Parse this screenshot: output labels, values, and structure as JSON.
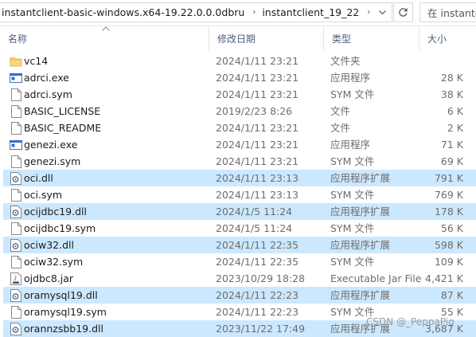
{
  "address_bar": {
    "crumbs": [
      "instantclient-basic-windows.x64-19.22.0.0.0dbru",
      "instantclient_19_22"
    ],
    "separator": "›",
    "dropdown_icon": "chevron-down-icon",
    "refresh_icon": "refresh-icon",
    "search_placeholder": "在 instantcl"
  },
  "columns": {
    "name": "名称",
    "date": "修改日期",
    "type": "类型",
    "size": "大小"
  },
  "colors": {
    "selected": "#cce8ff",
    "folder": "#f8d775",
    "dll_icon": "#5a6b85"
  },
  "files": [
    {
      "name": "vc14",
      "date": "2024/1/11 23:21",
      "type": "文件夹",
      "size": "",
      "icon": "folder-icon",
      "selected": false
    },
    {
      "name": "adrci.exe",
      "date": "2024/1/11 23:21",
      "type": "应用程序",
      "size": "28 K",
      "icon": "exe-icon",
      "selected": false
    },
    {
      "name": "adrci.sym",
      "date": "2024/1/11 23:21",
      "type": "SYM 文件",
      "size": "38 K",
      "icon": "file-icon",
      "selected": false
    },
    {
      "name": "BASIC_LICENSE",
      "date": "2019/2/23 8:26",
      "type": "文件",
      "size": "6 K",
      "icon": "file-icon",
      "selected": false
    },
    {
      "name": "BASIC_README",
      "date": "2024/1/11 23:21",
      "type": "文件",
      "size": "2 K",
      "icon": "file-icon",
      "selected": false
    },
    {
      "name": "genezi.exe",
      "date": "2024/1/11 23:21",
      "type": "应用程序",
      "size": "71 K",
      "icon": "exe-icon",
      "selected": false
    },
    {
      "name": "genezi.sym",
      "date": "2024/1/11 23:21",
      "type": "SYM 文件",
      "size": "69 K",
      "icon": "file-icon",
      "selected": false
    },
    {
      "name": "oci.dll",
      "date": "2024/1/11 23:13",
      "type": "应用程序扩展",
      "size": "791 K",
      "icon": "dll-icon",
      "selected": true
    },
    {
      "name": "oci.sym",
      "date": "2024/1/11 23:13",
      "type": "SYM 文件",
      "size": "769 K",
      "icon": "file-icon",
      "selected": false
    },
    {
      "name": "ocijdbc19.dll",
      "date": "2024/1/5 11:24",
      "type": "应用程序扩展",
      "size": "178 K",
      "icon": "dll-icon",
      "selected": true
    },
    {
      "name": "ocijdbc19.sym",
      "date": "2024/1/5 11:24",
      "type": "SYM 文件",
      "size": "56 K",
      "icon": "file-icon",
      "selected": false
    },
    {
      "name": "ociw32.dll",
      "date": "2024/1/11 22:35",
      "type": "应用程序扩展",
      "size": "598 K",
      "icon": "dll-icon",
      "selected": true
    },
    {
      "name": "ociw32.sym",
      "date": "2024/1/11 22:35",
      "type": "SYM 文件",
      "size": "109 K",
      "icon": "file-icon",
      "selected": false
    },
    {
      "name": "ojdbc8.jar",
      "date": "2023/10/29 18:28",
      "type": "Executable Jar File",
      "size": "4,421 K",
      "icon": "jar-icon",
      "selected": false
    },
    {
      "name": "oramysql19.dll",
      "date": "2024/1/11 22:23",
      "type": "应用程序扩展",
      "size": "87 K",
      "icon": "dll-icon",
      "selected": true
    },
    {
      "name": "oramysql19.sym",
      "date": "2024/1/11 22:23",
      "type": "SYM 文件",
      "size": "55 K",
      "icon": "file-icon",
      "selected": false
    },
    {
      "name": "orannzsbb19.dll",
      "date": "2023/11/22 17:49",
      "type": "应用程序扩展",
      "size": "3,687 K",
      "icon": "dll-icon",
      "selected": true
    }
  ],
  "watermark": "CSDN @_PeppaPig"
}
